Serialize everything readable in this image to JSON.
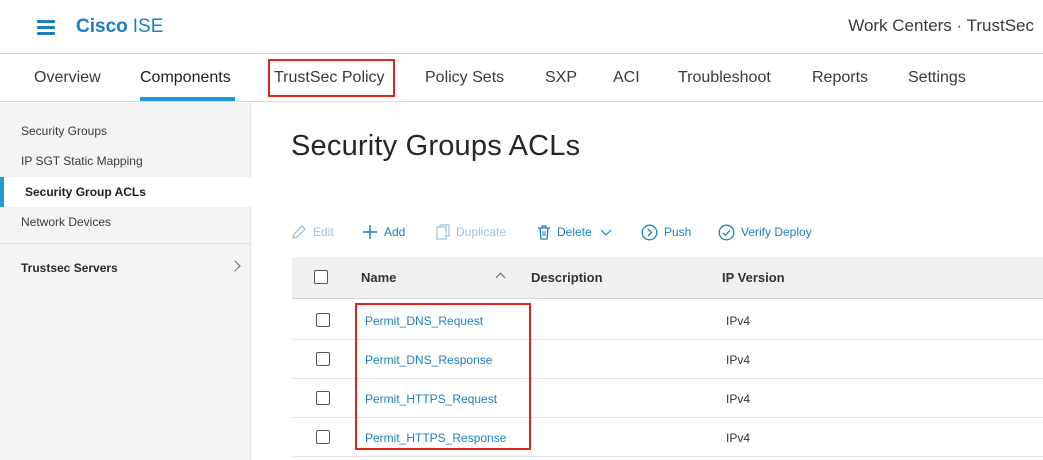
{
  "header": {
    "brand_bold": "Cisco",
    "brand_light": "ISE",
    "breadcrumb": "Work Centers · TrustSec"
  },
  "tabs": [
    {
      "label": "Overview"
    },
    {
      "label": "Components"
    },
    {
      "label": "TrustSec Policy"
    },
    {
      "label": "Policy Sets"
    },
    {
      "label": "SXP"
    },
    {
      "label": "ACI"
    },
    {
      "label": "Troubleshoot"
    },
    {
      "label": "Reports"
    },
    {
      "label": "Settings"
    }
  ],
  "active_tab": "Components",
  "sidebar": {
    "items": [
      {
        "label": "Security Groups"
      },
      {
        "label": "IP SGT Static Mapping"
      },
      {
        "label": "Security Group ACLs"
      },
      {
        "label": "Network Devices"
      }
    ],
    "active_item": "Security Group ACLs",
    "group": {
      "label": "Trustsec Servers"
    }
  },
  "main": {
    "title": "Security Groups ACLs",
    "toolbar": {
      "edit": "Edit",
      "add": "Add",
      "duplicate": "Duplicate",
      "delete": "Delete",
      "push": "Push",
      "verify_deploy": "Verify Deploy"
    },
    "table": {
      "columns": [
        "Name",
        "Description",
        "IP Version"
      ],
      "rows": [
        {
          "name": "Permit_DNS_Request",
          "description": "",
          "ip_version": "IPv4"
        },
        {
          "name": "Permit_DNS_Response",
          "description": "",
          "ip_version": "IPv4"
        },
        {
          "name": "Permit_HTTPS_Request",
          "description": "",
          "ip_version": "IPv4"
        },
        {
          "name": "Permit_HTTPS_Response",
          "description": "",
          "ip_version": "IPv4"
        }
      ]
    }
  },
  "colors": {
    "accent": "#1b7fbf",
    "active_indicator": "#1b9ad6",
    "highlight_box": "#e0261d",
    "disabled_action": "#9ec3de"
  },
  "icons": {
    "menu": "hamburger-icon",
    "edit": "pencil-icon",
    "add": "plus-icon",
    "duplicate": "copy-icon",
    "delete": "trash-icon",
    "push": "arrow-circle-icon",
    "verify": "check-circle-icon",
    "expand": "chevron-right-icon",
    "sort": "chevron-up-icon"
  }
}
